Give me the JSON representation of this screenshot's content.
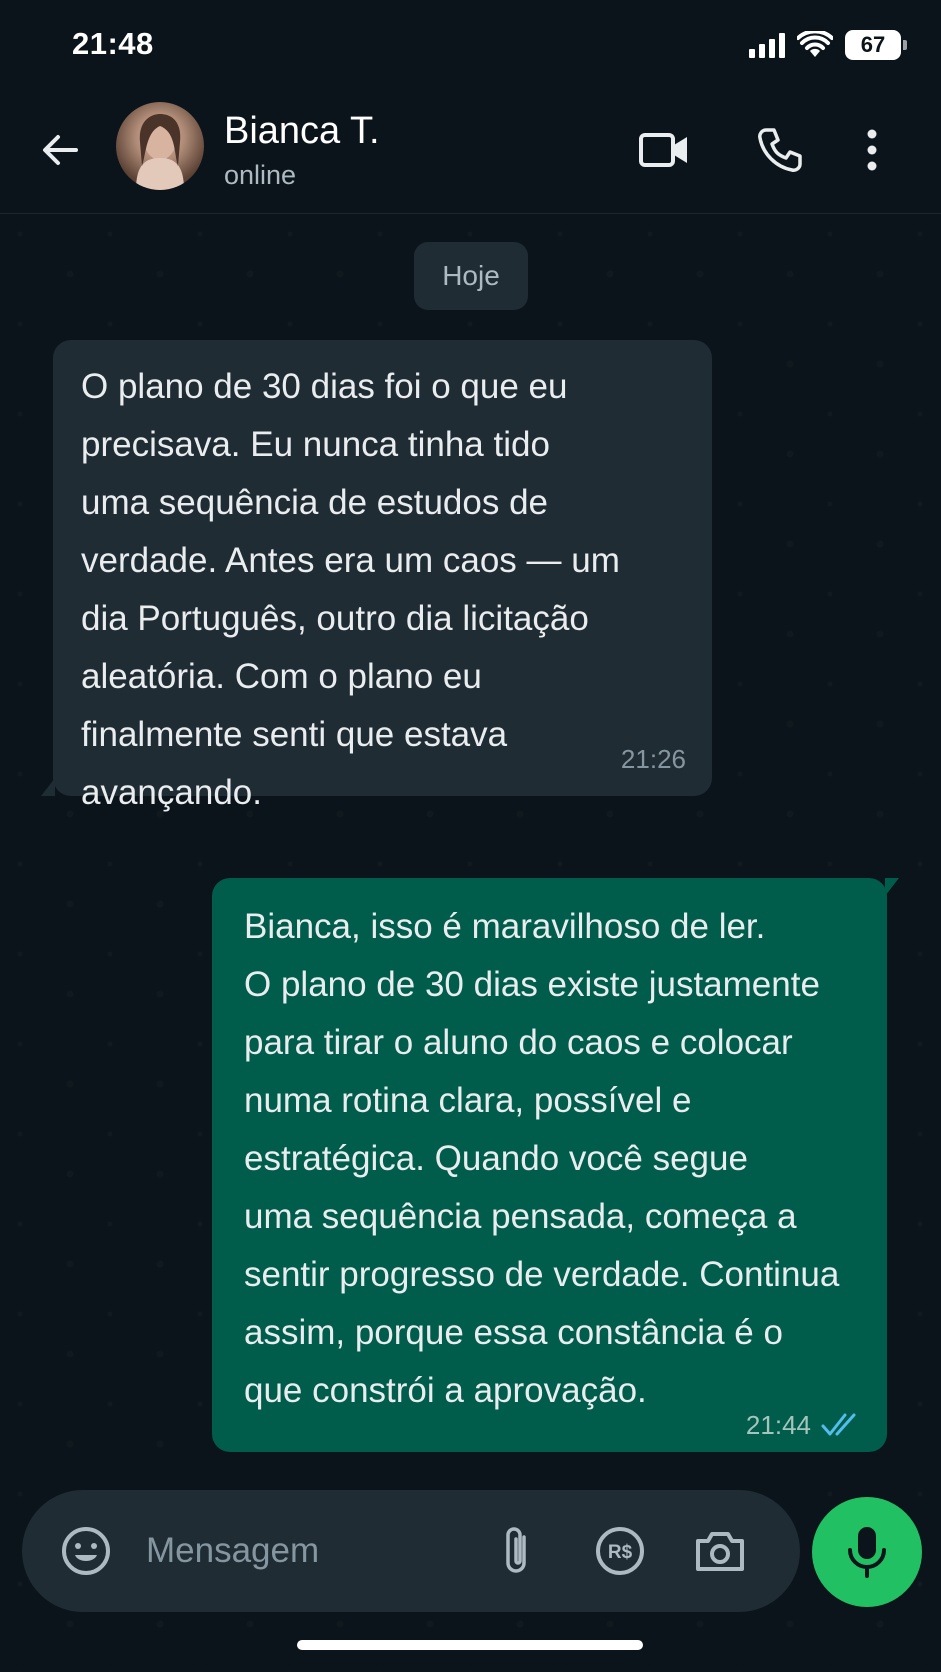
{
  "status_bar": {
    "time": "21:48",
    "battery": "67"
  },
  "header": {
    "contact_name": "Bianca T.",
    "contact_status": "online"
  },
  "chat": {
    "date_chip": "Hoje",
    "messages": [
      {
        "direction": "incoming",
        "text": "O plano de 30 dias foi o que eu\nprecisava. Eu nunca tinha tido\numa sequência de estudos de\nverdade. Antes era um caos — um\ndia Português, outro dia licitação\naleatória. Com o plano eu\nfinalmente senti que estava\navançando.",
        "time": "21:26"
      },
      {
        "direction": "outgoing",
        "text": "Bianca, isso é maravilhoso de ler.\nO plano de 30 dias existe justamente\npara tirar o aluno do caos e colocar\nnuma rotina clara, possível e\nestratégica. Quando você segue\numa sequência pensada, começa a\nsentir progresso de verdade. Continua\nassim, porque essa constância é o\nque constrói a aprovação.",
        "time": "21:44",
        "read": true
      }
    ]
  },
  "composer": {
    "placeholder": "Mensagem"
  },
  "colors": {
    "accent": "#21c063",
    "outgoing_bubble": "#005c4b",
    "incoming_bubble": "#202c33",
    "read_ticks": "#53bdeb"
  },
  "icons": [
    "back-arrow-icon",
    "video-call-icon",
    "phone-icon",
    "more-options-icon",
    "emoji-icon",
    "attach-icon",
    "payment-icon",
    "camera-icon",
    "mic-icon",
    "double-check-icon"
  ]
}
